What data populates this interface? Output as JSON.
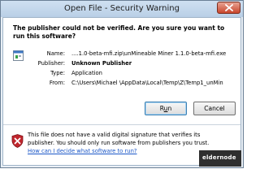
{
  "window": {
    "title": "Open File - Security Warning"
  },
  "warning": {
    "message": "The publisher could not be verified. Are you sure you want to run this software?"
  },
  "details": [
    {
      "label": "Name:",
      "value": "....1.0-beta-mfi.zip\\unMineable Miner 1.1.0-beta-mfi.exe",
      "bold": false
    },
    {
      "label": "Publisher:",
      "value": "Unknown Publisher",
      "bold": true
    },
    {
      "label": "Type:",
      "value": "Application",
      "bold": false
    },
    {
      "label": "From:",
      "value": "C:\\Users\\Michael \\AppData\\Local\\Temp\\Z\\Temp1_unMin",
      "bold": false
    }
  ],
  "buttons": {
    "run_first": "R",
    "run_underline": "u",
    "run_rest": "n",
    "cancel": "Cancel"
  },
  "footer": {
    "message": "This file does not have a valid digital signature that verifies its publisher. You should only run software from publishers you trust.",
    "link": "How can I decide what software to run?"
  },
  "watermark": {
    "text": "eldernode"
  },
  "colors": {
    "link": "#1a56c7",
    "close_button": "#c9462c",
    "shield": "#c0262d"
  },
  "icons": [
    "close-icon",
    "application-file-icon",
    "security-shield-icon"
  ]
}
